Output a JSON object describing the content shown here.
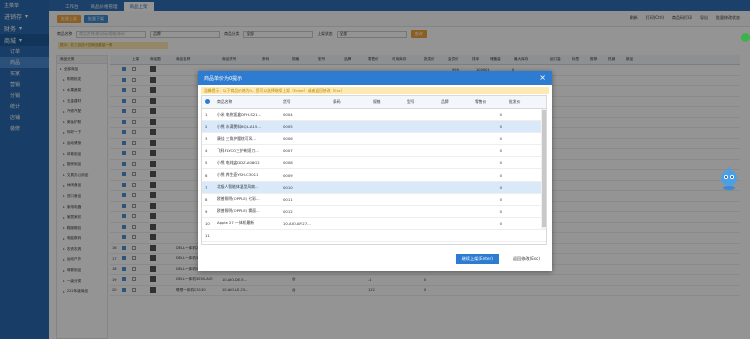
{
  "nav": {
    "top_label": "主菜单",
    "groups": [
      {
        "label": "进销存",
        "arrow": "▾"
      },
      {
        "label": "财务",
        "arrow": "▾"
      },
      {
        "label": "商城",
        "arrow": "▾"
      }
    ],
    "items": [
      "订单",
      "商品",
      "买家",
      "营销",
      "分销",
      "统计",
      "店铺",
      "装修"
    ]
  },
  "tabs": [
    "工作台",
    "商品价格管理",
    "商品上架"
  ],
  "toolbar": {
    "left_buttons": [
      "批量上架",
      "批量下架"
    ],
    "right_links": [
      "刷新",
      "打印(Ctrl)",
      "商品码打印",
      "导出",
      "批量修改状态"
    ]
  },
  "filter": {
    "name_label": "商品名称",
    "name_placeholder": "商品名称/助记码/规格/条码",
    "name_value": "品牌",
    "category_label": "商品分类",
    "category_value": "全部",
    "status_label": "上架状态",
    "status_value": "全部",
    "query_button": "查询"
  },
  "hint": "提示：共三百四十四商品数量一条",
  "tree": {
    "header": "商品分类",
    "nodes": [
      "全部商品",
      "购物批发",
      "水果蔬菜",
      "五金建材",
      "汽修汽配",
      "美妆护肤",
      "你好一下",
      "运动健身",
      "体育用品",
      "厨房用品",
      "文具办公用品",
      "休闲食品",
      "进口食品",
      "家用电器",
      "家居家纺",
      "鞋服箱包",
      "电脑数码",
      "农资农具",
      "运动户外",
      "母婴用品",
      "一级分类",
      "222年级商品"
    ]
  },
  "grid": {
    "headers": [
      "",
      "",
      "上架",
      "商品图",
      "商品名称",
      "商品货号",
      "条码",
      "规格",
      "型号",
      "品牌",
      "零售价",
      "可用库存",
      "批发价",
      "会员价",
      "排序",
      "储备量",
      "最大库存",
      "起订量",
      "标签",
      "推荐",
      "热销",
      "新品"
    ],
    "rows": [
      {
        "no": "16",
        "name": "DELL一体机2459-R1646",
        "code": "10.AIO.DE.5...",
        "unit": "台",
        "price": "-1",
        "stock": "0"
      },
      {
        "no": "17",
        "name": "DELL一体机3030-AIO",
        "code": "10.AIO.DE.5...",
        "unit": "台",
        "price": "-1",
        "stock": "0"
      },
      {
        "no": "18",
        "name": "DELL一体机5459-R1846",
        "code": "10.AIO.DE.5...",
        "unit": "台",
        "price": "-1",
        "stock": "0"
      },
      {
        "no": "19",
        "name": "DELL一体机3030-AIO",
        "code": "10.AIO.DE.5...",
        "unit": "台",
        "price": "-1",
        "stock": "0"
      },
      {
        "no": "20",
        "name": "联想一体机C5130",
        "code": "10.AIO.LE.23...",
        "unit": "台",
        "price": "122",
        "stock": "0"
      }
    ],
    "top_values": {
      "reserve": "999",
      "max": "100001",
      "min": "0"
    }
  },
  "modal": {
    "title": "商品单价为0提示",
    "note": "温馨提示：以下商品价格为0，您可以选择继续上架（Enter）或者返回修改（Esc）",
    "headers": [
      "",
      "商品名称",
      "货号",
      "条码",
      "规格",
      "型号",
      "品牌",
      "零售价",
      "批发价"
    ],
    "rows": [
      {
        "n": "1",
        "name": "小米 电热饭盒DFH-S21...",
        "code": "0004",
        "price": "0"
      },
      {
        "n": "2",
        "name": "小熊 水满煲料BQL-A15...",
        "code": "0005",
        "price": "0"
      },
      {
        "n": "3",
        "name": "康佳 三角护腰枕可风...",
        "code": "0006",
        "price": "0"
      },
      {
        "n": "4",
        "name": "飞科FLYCO三护剃须刀...",
        "code": "0007",
        "price": "0"
      },
      {
        "n": "5",
        "name": "小熊 电炖盅DDZ-A08G2",
        "code": "0008",
        "price": "0"
      },
      {
        "n": "6",
        "name": "小熊 养生壶YSH-C3011",
        "code": "0009",
        "price": "0"
      },
      {
        "n": "7",
        "name": "北极人智能体温型风扇...",
        "code": "0010",
        "price": "0"
      },
      {
        "n": "8",
        "name": "欧普照明(OPPLE) 七彩...",
        "code": "0011",
        "price": "0"
      },
      {
        "n": "9",
        "name": "欧普照明(OPPLE) 雾面...",
        "code": "0012",
        "price": "0"
      },
      {
        "n": "10",
        "name": "Apple 27 一体机最新",
        "code": "10.AIO.AP.27...",
        "price": "0"
      },
      {
        "n": "11",
        "name": "",
        "code": "",
        "price": ""
      }
    ],
    "selected_rows": [
      1,
      6
    ],
    "continue_button": "继续上架(Enter)",
    "back_button": "返回修改(Esc)"
  }
}
